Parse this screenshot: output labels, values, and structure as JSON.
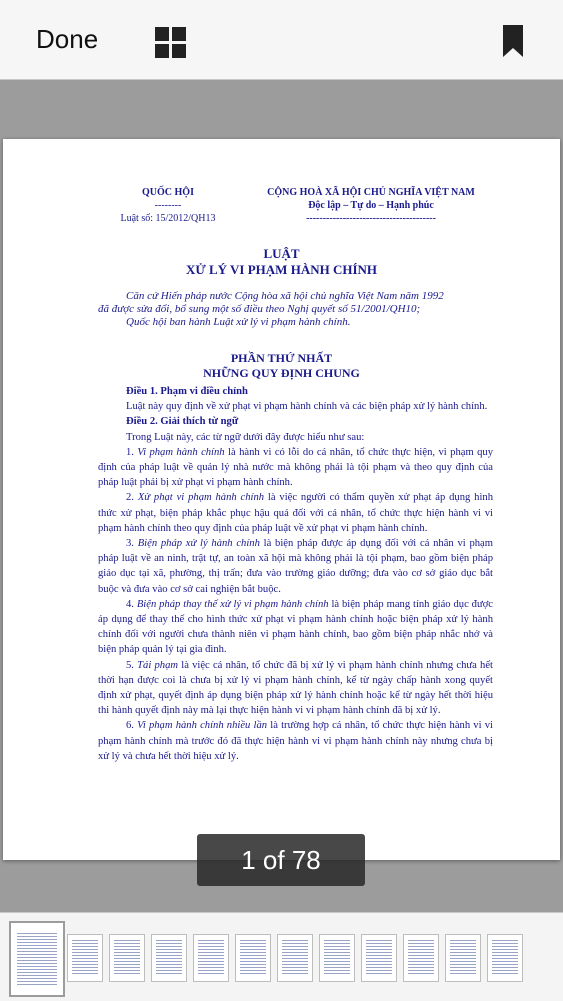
{
  "toolbar": {
    "done_label": "Done",
    "grid_icon": "grid-view-icon",
    "bookmark_icon": "bookmark-icon"
  },
  "document": {
    "header_left": {
      "org": "QUỐC HỘI",
      "dashes": "--------",
      "law_number": "Luật số: 15/2012/QH13"
    },
    "header_right": {
      "nation": "CỘNG HOÀ XÃ HỘI CHỦ NGHĨA VIỆT NAM",
      "motto": "Độc lập – Tự do – Hạnh phúc",
      "dashes": "---------------------------------------"
    },
    "title_line1": "LUẬT",
    "title_line2": "XỬ LÝ VI PHẠM HÀNH CHÍNH",
    "preamble": [
      "Căn cứ Hiến pháp nước Cộng hòa xã hội chủ nghĩa Việt Nam năm 1992",
      "đã được sửa đổi, bổ sung một số điều theo Nghị quyết số 51/2001/QH10;",
      "Quốc hội ban hành Luật xử lý vi phạm hành chính."
    ],
    "part_line1": "PHẦN THỨ NHẤT",
    "part_line2": "NHỮNG QUY ĐỊNH CHUNG",
    "article1_title": "Điều 1. Phạm vi điều chỉnh",
    "article1_text": "Luật này quy định về xử phạt vi phạm hành chính và các biện pháp xử lý hành chính.",
    "article2_title": "Điều 2. Giải thích từ ngữ",
    "article2_intro": "Trong Luật này, các từ ngữ dưới đây được hiểu như sau:",
    "items": [
      {
        "num": "1. ",
        "term": "Vi phạm hành chính",
        "text": " là hành vi có lỗi do cá nhân, tổ chức thực hiện, vi phạm quy định của pháp luật về quản lý nhà nước mà không phải là tội phạm và theo quy định của pháp luật phải bị xử phạt vi phạm hành chính."
      },
      {
        "num": "2. ",
        "term": "Xử phạt vi phạm hành chính",
        "text": " là việc người có thẩm quyền xử phạt áp dụng hình thức xử phạt, biện pháp khắc phục hậu quả đối với cá nhân, tổ chức thực hiện hành vi vi phạm hành chính theo quy định của pháp luật về xử phạt vi phạm hành chính."
      },
      {
        "num": "3. ",
        "term": "Biện pháp xử lý hành chính",
        "text": " là biện pháp được áp dụng đối với cá nhân vi phạm pháp luật về an ninh, trật tự, an toàn xã hội mà không phải là tội phạm, bao gồm biện pháp giáo dục tại xã, phường, thị trấn; đưa vào trường giáo dưỡng; đưa vào cơ sở giáo dục bắt buộc và đưa vào cơ sở cai nghiện bắt buộc."
      },
      {
        "num": "4. ",
        "term": "Biện pháp thay thế xử lý vi phạm hành chính",
        "text": " là biện pháp mang tính giáo dục được áp dụng để thay thế cho hình thức xử phạt vi phạm hành chính hoặc biện pháp xử lý hành chính đối với người chưa thành niên vi phạm hành chính, bao gồm biện pháp nhắc nhở và biện pháp quản lý tại gia đình."
      },
      {
        "num": "5. ",
        "term": "Tái phạm",
        "text": " là việc cá nhân, tổ chức đã bị xử lý vi phạm hành chính nhưng chưa hết thời hạn được coi là chưa bị xử lý vi phạm hành chính, kể từ ngày chấp hành xong quyết định xử phạt, quyết định áp dụng biện pháp xử lý hành chính hoặc kể từ ngày hết thời hiệu thi hành quyết định này mà lại thực hiện hành vi vi phạm hành chính đã bị xử lý."
      },
      {
        "num": "6. ",
        "term": "Vi phạm hành chính nhiều lần",
        "text": " là trường hợp cá nhân, tổ chức thực hiện hành vi vi phạm hành chính mà trước đó đã thực hiện hành vi vi phạm hành chính này nhưng chưa bị xử lý và chưa hết thời hiệu xử lý."
      }
    ]
  },
  "page_counter": "1 of 78",
  "thumbnails": {
    "count": 12,
    "current_index": 0
  }
}
